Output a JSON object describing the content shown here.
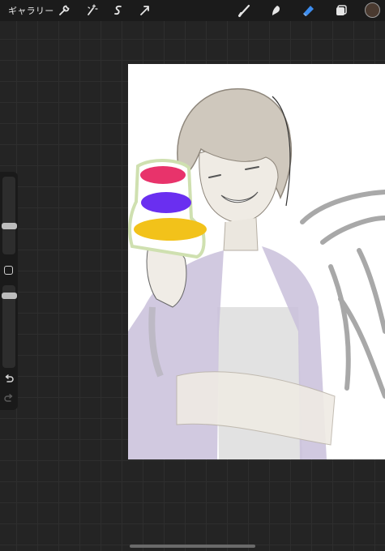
{
  "toolbar": {
    "gallery_label": "ギャラリー",
    "left_icons": [
      "wrench-icon",
      "magic-wand-icon",
      "selection-icon",
      "transform-arrow-icon"
    ],
    "right_icons": [
      "brush-icon",
      "smudge-icon",
      "eraser-icon",
      "layers-icon"
    ],
    "active_tool": "eraser",
    "accent_color": "#3d8ef0",
    "current_color": "#4a3a30"
  },
  "sidebar": {
    "brush_size_level": 0.35,
    "opacity_level": 0.1,
    "buttons": [
      "modify-icon",
      "undo-icon",
      "redo-icon"
    ]
  },
  "canvas": {
    "background": "#ffffff",
    "artwork": "sketch-of-smiling-person-holding-color-palette",
    "palette_colors": [
      "#e8336b",
      "#6a2ff0",
      "#f2c21a"
    ]
  }
}
